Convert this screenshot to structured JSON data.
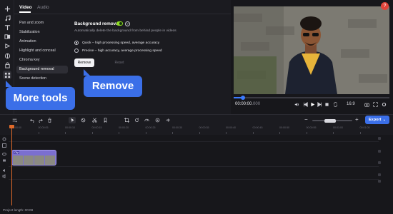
{
  "tabs": {
    "video": "Video",
    "audio": "Audio"
  },
  "menu": [
    {
      "label": "Pan and zoom",
      "selected": false
    },
    {
      "label": "Stabilization",
      "selected": false
    },
    {
      "label": "Animation",
      "selected": false
    },
    {
      "label": "Highlight and conceal",
      "selected": false
    },
    {
      "label": "Chroma key",
      "selected": false
    },
    {
      "label": "Background removal",
      "selected": true
    },
    {
      "label": "Scene detection",
      "selected": false
    }
  ],
  "option": {
    "title": "Background removal",
    "help": "?",
    "description": "Automatically delete the background from behind people in videos",
    "radio_quick": "Quick – high processing speed, average accuracy",
    "radio_precise": "Precise – high accuracy, average processing speed",
    "remove": "Remove",
    "reset": "Reset"
  },
  "callouts": {
    "more_tools": "More tools",
    "remove": "Remove"
  },
  "player": {
    "time_current": "00:00:00",
    "time_fraction": ".000",
    "aspect": "16:9",
    "progress": 0.06,
    "close": "?"
  },
  "timeline": {
    "export": "Export",
    "ruler": [
      "00:00:00",
      "00:00:05",
      "00:00:10",
      "00:00:15",
      "00:00:20",
      "00:00:25",
      "00:00:30",
      "00:00:35",
      "00:00:40",
      "00:00:45",
      "00:00:50",
      "00:00:55",
      "00:01:00",
      "00:01:05"
    ],
    "clip_label": "Clip",
    "zoom_level": 0.45,
    "project_length": "Project length: 00:08"
  },
  "colors": {
    "accent": "#3b6fe8",
    "toggle": "#8fdc24",
    "clip": "#7b6fd0",
    "playhead": "#e06a2a"
  },
  "icons": {
    "rail": [
      "plus-icon",
      "music-icon",
      "text-icon",
      "transition-icon",
      "sticker-icon",
      "filter-icon",
      "clock-icon",
      "lock-icon",
      "more-tools-icon"
    ],
    "timeline_tools": [
      "add-track-icon",
      "undo-icon",
      "redo-icon",
      "delete-icon",
      "select-icon",
      "magnet-icon",
      "scissors-icon",
      "split-icon",
      "marker-icon",
      "crop-icon",
      "rotate-icon",
      "speed-icon",
      "sticker-icon"
    ]
  }
}
